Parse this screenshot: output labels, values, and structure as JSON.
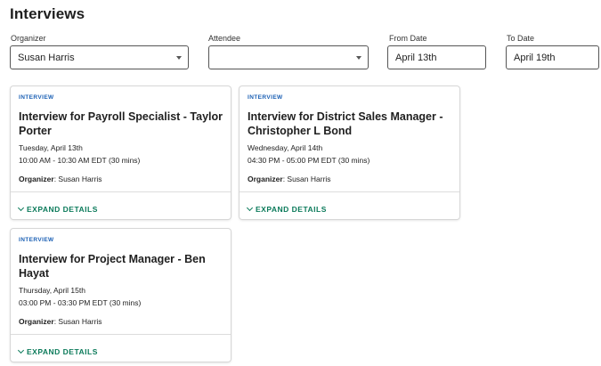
{
  "page": {
    "title": "Interviews"
  },
  "filters": {
    "organizer": {
      "label": "Organizer",
      "value": "Susan Harris"
    },
    "attendee": {
      "label": "Attendee",
      "value": ""
    },
    "from_date": {
      "label": "From Date",
      "value": "April 13th"
    },
    "to_date": {
      "label": "To Date",
      "value": "April 19th"
    }
  },
  "cards": [
    {
      "tag": "INTERVIEW",
      "title": "Interview for Payroll Specialist - Taylor Porter",
      "day": "Tuesday, April 13th",
      "time": "10:00 AM - 10:30 AM EDT (30 mins)",
      "organizer_label": "Organizer",
      "organizer": ": Susan Harris",
      "expand": "EXPAND DETAILS"
    },
    {
      "tag": "INTERVIEW",
      "title": "Interview for District Sales Manager - Christopher L Bond",
      "day": "Wednesday, April 14th",
      "time": "04:30 PM - 05:00 PM EDT (30 mins)",
      "organizer_label": "Organizer",
      "organizer": ": Susan Harris",
      "expand": "EXPAND DETAILS"
    },
    {
      "tag": "INTERVIEW",
      "title": "Interview for Project Manager - Ben Hayat",
      "day": "Thursday, April 15th",
      "time": "03:00 PM - 03:30 PM EDT (30 mins)",
      "organizer_label": "Organizer",
      "organizer": ": Susan Harris",
      "expand": "EXPAND DETAILS"
    }
  ],
  "colors": {
    "tag": "#1a5fb4",
    "expand": "#0b7a5a"
  },
  "icons": {
    "select": "chevron-down-icon",
    "expand": "chevron-down-icon"
  }
}
